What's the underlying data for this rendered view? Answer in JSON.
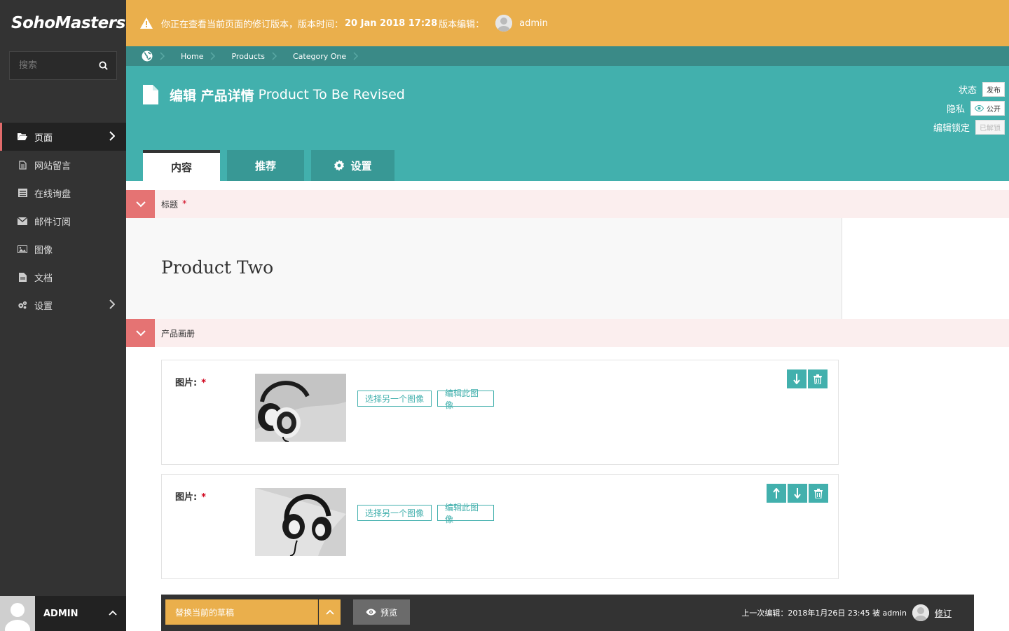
{
  "app": {
    "logo": "SohoMasters."
  },
  "search": {
    "placeholder": "搜索"
  },
  "sidebar": {
    "items": [
      {
        "label": "页面"
      },
      {
        "label": "网站留言"
      },
      {
        "label": "在线询盘"
      },
      {
        "label": "邮件订阅"
      },
      {
        "label": "图像"
      },
      {
        "label": "文档"
      },
      {
        "label": "设置"
      }
    ],
    "user": "ADMIN"
  },
  "warning": {
    "prefix": "你正在查看当前页面的修订版本，版本时间：",
    "time": "20 Jan 2018 17:28",
    "suffix": "版本编辑：",
    "editor": "admin"
  },
  "breadcrumb": {
    "items": [
      "Home",
      "Products",
      "Category One"
    ]
  },
  "header": {
    "title_prefix": "编辑 产品详情",
    "title": "Product To Be Revised",
    "status_label": "状态",
    "status_value": "发布",
    "privacy_label": "隐私",
    "privacy_value": "公开",
    "lock_label": "编辑锁定",
    "lock_value": "已解锁"
  },
  "tabs": [
    {
      "label": "内容"
    },
    {
      "label": "推荐"
    },
    {
      "label": "设置"
    }
  ],
  "sections": {
    "title_label": "标题",
    "title_value": "Product Two",
    "gallery_label": "产品画册"
  },
  "gallery": {
    "items": [
      {
        "label": "图片:",
        "choose_label": "选择另一个图像",
        "edit_label": "编辑此图像"
      },
      {
        "label": "图片:",
        "choose_label": "选择另一个图像",
        "edit_label": "编辑此图像"
      }
    ]
  },
  "action_bar": {
    "replace_label": "替换当前的草稿",
    "preview_label": "预览",
    "last_edit_prefix": "上一次编辑：",
    "last_edit_time": "2018年1月26日 23:45 被 admin",
    "revisions_label": "修订"
  },
  "colors": {
    "teal": "#42b0ad",
    "teal_dark": "#3a8a87",
    "orange": "#eaaf4c",
    "sidebar": "#333333",
    "accent_red": "#e57373"
  }
}
